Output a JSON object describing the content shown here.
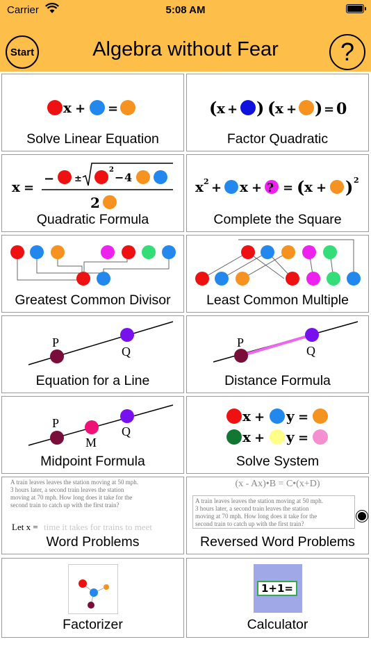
{
  "status_bar": {
    "carrier": "Carrier",
    "time": "5:08 AM"
  },
  "header": {
    "start_label": "Start",
    "title": "Algebra without Fear",
    "help_label": "?"
  },
  "tiles": [
    {
      "label": "Solve Linear Equation"
    },
    {
      "label": "Factor Quadratic"
    },
    {
      "label": "Quadratic Formula"
    },
    {
      "label": "Complete the Square"
    },
    {
      "label": "Greatest Common Divisor"
    },
    {
      "label": "Least Common Multiple"
    },
    {
      "label": "Equation for a Line"
    },
    {
      "label": "Distance Formula"
    },
    {
      "label": "Midpoint Formula"
    },
    {
      "label": "Solve System"
    },
    {
      "label": "Word Problems"
    },
    {
      "label": "Reversed Word Problems"
    },
    {
      "label": "Factorizer"
    },
    {
      "label": "Calculator"
    }
  ],
  "icon_text": {
    "x": "x",
    "y": "y",
    "plus": "+",
    "equals": "=",
    "zero": "0",
    "open_paren": "(",
    "close_paren": ")",
    "minus": "−",
    "plus_minus": "±",
    "square": "2",
    "four": "4",
    "two": "2",
    "question": "?",
    "point_p": "P",
    "point_q": "Q",
    "point_m": "M",
    "reversed_formula": "(x - Ax)•B = C•(x+D)",
    "calculator_display": "1+1="
  },
  "word_problem": {
    "text_line1": "A train leaves leaves the station moving at 50 mph.",
    "text_line2": "3 hours later, a second train leaves the station",
    "text_line3": "moving at 70 mph.  How long does it take for the",
    "text_line4": "second train to catch up with the first train?",
    "let_x": "Let x =",
    "answer_hint": "time it takes for trains to meet"
  },
  "colors": {
    "header_bg": "#fdbf4a",
    "red": "#ee1111",
    "blue": "#2288ee",
    "orange": "#f59220",
    "navy": "#1111dd",
    "magenta": "#ee22ee",
    "green": "#33dd77",
    "maroon": "#7a0e3a",
    "purple": "#7711ee",
    "pink": "#ee1177",
    "darkgreen": "#117733",
    "yellow": "#ffff88",
    "lightpink": "#f48fd0",
    "line_magenta": "#ee66ee"
  }
}
